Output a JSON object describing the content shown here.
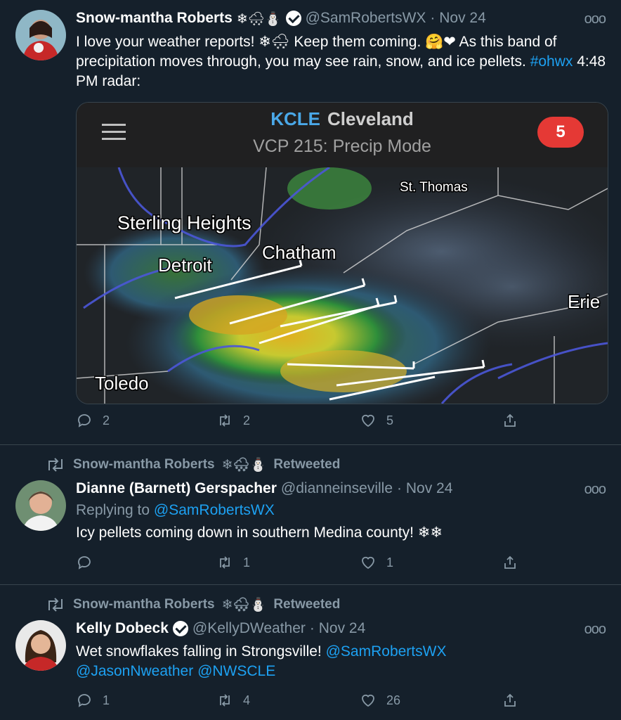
{
  "tweets": [
    {
      "name": "Snow-mantha Roberts",
      "name_emoji": "❄🌨⛄",
      "handle": "@SamRobertsWX",
      "time": "· Nov 24",
      "text_1": "I love your weather reports! ❄🌨 Keep them coming. 🤗❤ As this band of precipitation moves through, you may see rain, snow, and ice pellets.",
      "hashtag": "#ohwx",
      "text_2": " 4:48 PM radar:",
      "replies": "2",
      "retweets": "2",
      "likes": "5"
    },
    {
      "retweeted_by": "Snow-mantha Roberts",
      "retweeted_emoji": "❄🌨⛄",
      "retweeted_label": "Retweeted",
      "name": "Dianne (Barnett) Gerspacher",
      "handle": "@dianneinseville",
      "time": "· Nov 24",
      "reply_prefix": "Replying to ",
      "reply_to": "@SamRobertsWX",
      "text": "Icy pellets coming down in southern Medina county! ❄❄",
      "replies": "",
      "retweets": "1",
      "likes": "1"
    },
    {
      "retweeted_by": "Snow-mantha Roberts",
      "retweeted_emoji": "❄🌨⛄",
      "retweeted_label": "Retweeted",
      "name": "Kelly Dobeck",
      "handle": "@KellyDWeather",
      "time": "· Nov 24",
      "text": "Wet snowflakes falling in Strongsville! ",
      "mention_1": "@SamRobertsWX",
      "mention_2": "@JasonNweather",
      "mention_3": "@NWSCLE",
      "replies": "1",
      "retweets": "4",
      "likes": "26"
    }
  ],
  "radar": {
    "station": "KCLE",
    "city": "Cleveland",
    "mode": "VCP 215: Precip Mode",
    "badge": "5",
    "labels": {
      "st_thomas": "St. Thomas",
      "sterling_heights": "Sterling Heights",
      "chatham": "Chatham",
      "detroit": "Detroit",
      "erie": "Erie",
      "toledo": "Toledo"
    }
  },
  "icons": {
    "reply": "reply-icon",
    "retweet": "retweet-icon",
    "like": "heart-icon",
    "share": "share-icon",
    "more": "more-icon"
  },
  "colors": {
    "background": "#15202b",
    "link": "#1da1f2",
    "muted": "#8899a6",
    "badge": "#e53935",
    "radar_station": "#4aa8e8"
  },
  "more_label": "ooo"
}
